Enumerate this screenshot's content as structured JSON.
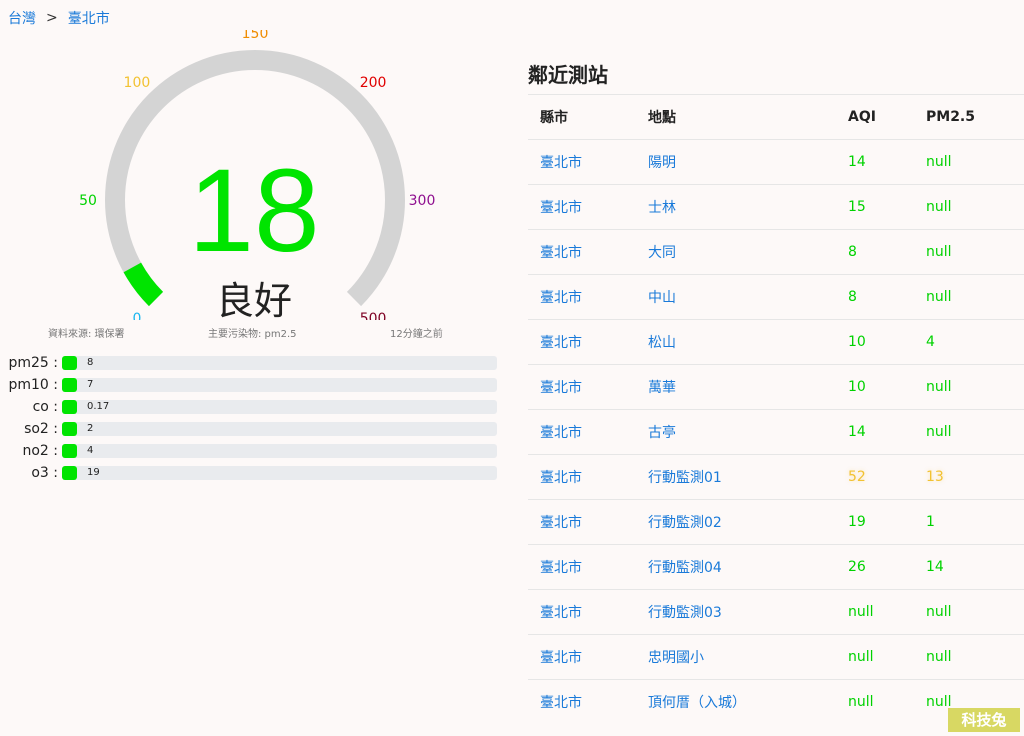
{
  "breadcrumb": {
    "country": "台灣",
    "separator": ">",
    "city": "臺北市"
  },
  "gauge": {
    "value": "18",
    "status": "良好",
    "range_max": 500,
    "ticks": [
      {
        "label": "0",
        "value": 0,
        "color": "#1bb7f0"
      },
      {
        "label": "50",
        "value": 50,
        "color": "#00d200"
      },
      {
        "label": "100",
        "value": 100,
        "color": "#f2c232"
      },
      {
        "label": "150",
        "value": 150,
        "color": "#f08c00"
      },
      {
        "label": "200",
        "value": 200,
        "color": "#e00000"
      },
      {
        "label": "300",
        "value": 300,
        "color": "#8f0f8f"
      },
      {
        "label": "500",
        "value": 500,
        "color": "#7e0023"
      }
    ],
    "fill_color": "#00e400",
    "track_color": "#d4d4d4"
  },
  "meta": {
    "source": "資料來源: 環保署",
    "main_pollutant": "主要污染物: pm2.5",
    "updated": "12分鐘之前"
  },
  "pollutants": [
    {
      "name": "pm25 :",
      "value": "8"
    },
    {
      "name": "pm10 :",
      "value": "7"
    },
    {
      "name": "co :",
      "value": "0.17"
    },
    {
      "name": "so2 :",
      "value": "2"
    },
    {
      "name": "no2 :",
      "value": "4"
    },
    {
      "name": "o3 :",
      "value": "19"
    }
  ],
  "stations": {
    "title": "鄰近測站",
    "headers": {
      "city": "縣市",
      "location": "地點",
      "aqi": "AQI",
      "pm25": "PM2.5"
    },
    "rows": [
      {
        "city": "臺北市",
        "location": "陽明",
        "aqi": "14",
        "pm25": "null",
        "level": "good"
      },
      {
        "city": "臺北市",
        "location": "士林",
        "aqi": "15",
        "pm25": "null",
        "level": "good"
      },
      {
        "city": "臺北市",
        "location": "大同",
        "aqi": "8",
        "pm25": "null",
        "level": "good"
      },
      {
        "city": "臺北市",
        "location": "中山",
        "aqi": "8",
        "pm25": "null",
        "level": "good"
      },
      {
        "city": "臺北市",
        "location": "松山",
        "aqi": "10",
        "pm25": "4",
        "level": "good"
      },
      {
        "city": "臺北市",
        "location": "萬華",
        "aqi": "10",
        "pm25": "null",
        "level": "good"
      },
      {
        "city": "臺北市",
        "location": "古亭",
        "aqi": "14",
        "pm25": "null",
        "level": "good"
      },
      {
        "city": "臺北市",
        "location": "行動監測01",
        "aqi": "52",
        "pm25": "13",
        "level": "moderate"
      },
      {
        "city": "臺北市",
        "location": "行動監測02",
        "aqi": "19",
        "pm25": "1",
        "level": "good"
      },
      {
        "city": "臺北市",
        "location": "行動監測04",
        "aqi": "26",
        "pm25": "14",
        "level": "good"
      },
      {
        "city": "臺北市",
        "location": "行動監測03",
        "aqi": "null",
        "pm25": "null",
        "level": "good"
      },
      {
        "city": "臺北市",
        "location": "忠明國小",
        "aqi": "null",
        "pm25": "null",
        "level": "good"
      },
      {
        "city": "臺北市",
        "location": "頂何厝（入城）",
        "aqi": "null",
        "pm25": "null",
        "level": "good"
      }
    ]
  },
  "watermark": "科技兔"
}
